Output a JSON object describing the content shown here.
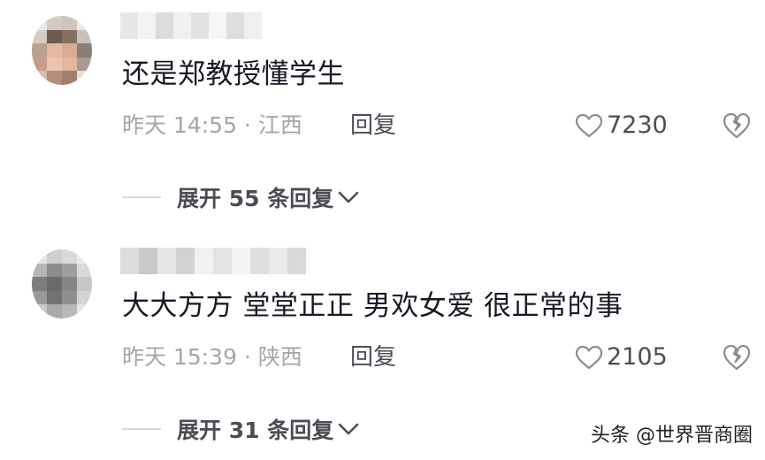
{
  "comments": [
    {
      "text": "还是郑教授懂学生",
      "time_location": "昨天 14:55 · 江西",
      "reply_label": "回复",
      "likes": "7230",
      "expand_label": "展开 55 条回复"
    },
    {
      "text": "大大方方  堂堂正正  男欢女爱  很正常的事",
      "time_location": "昨天 15:39 · 陕西",
      "reply_label": "回复",
      "likes": "2105",
      "expand_label": "展开 31 条回复"
    }
  ],
  "watermark": "头条 @世界晋商圈",
  "colors": {
    "text_primary": "#161823",
    "text_secondary": "#a4a6ab",
    "action": "#4b4d55"
  },
  "icons": {
    "like": "heart-outline-icon",
    "dislike": "broken-heart-icon",
    "expand": "chevron-down-icon"
  }
}
